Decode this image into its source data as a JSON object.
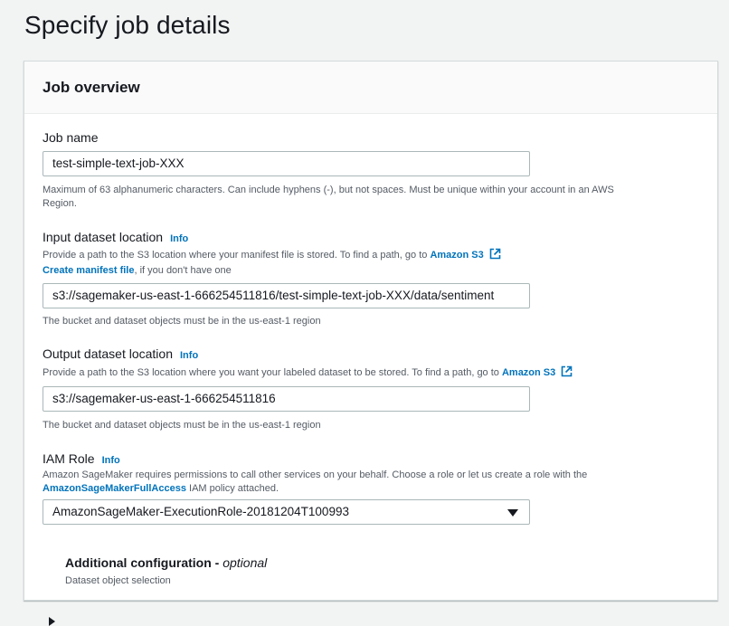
{
  "page": {
    "title": "Specify job details"
  },
  "panel": {
    "title": "Job overview",
    "job_name": {
      "label": "Job name",
      "value": "test-simple-text-job-XXX",
      "help_line1": "Maximum of 63 alphanumeric characters. Can include hyphens (-), but not spaces. Must be unique within your account in an AWS",
      "help_line2": "Region."
    },
    "input_location": {
      "label": "Input dataset location",
      "info": "Info",
      "desc_prefix": "Provide a path to the S3 location where your manifest file is stored. To find a path, go to ",
      "s3_link": "Amazon S3",
      "create_manifest_link": "Create manifest file",
      "create_manifest_suffix": ", if you don't have one",
      "value": "s3://sagemaker-us-east-1-666254511816/test-simple-text-job-XXX/data/sentiment",
      "help": "The bucket and dataset objects must be in the us-east-1 region"
    },
    "output_location": {
      "label": "Output dataset location",
      "info": "Info",
      "desc_prefix": "Provide a path to the S3 location where you want your labeled dataset to be stored. To find a path, go to ",
      "s3_link": "Amazon S3",
      "value": "s3://sagemaker-us-east-1-666254511816",
      "help": "The bucket and dataset objects must be in the us-east-1 region"
    },
    "iam_role": {
      "label": "IAM Role",
      "info": "Info",
      "desc": "Amazon SageMaker requires permissions to call other services on your behalf. Choose a role or let us create a role with the",
      "policy_link": "AmazonSageMakerFullAccess",
      "policy_suffix": " IAM policy attached.",
      "selected": "AmazonSageMaker-ExecutionRole-20181204T100993"
    },
    "additional": {
      "title": "Additional configuration",
      "separator": " - ",
      "optional": "optional",
      "desc": "Dataset object selection"
    }
  },
  "colors": {
    "link": "#0073bb",
    "text": "#16191f",
    "muted": "#545b64",
    "border": "#aab7b8",
    "background": "#f2f3f3"
  }
}
